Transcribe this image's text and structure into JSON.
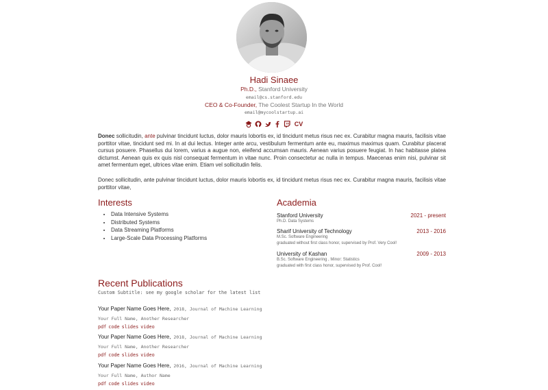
{
  "profile": {
    "name": "Hadi Sinaee",
    "degree": "Ph.D.,",
    "university": "Stanford University",
    "email1": "email@cs.stanford.edu",
    "role": "CEO & Co-Founder,",
    "company": "The Coolest Startup In the World",
    "email2": "email@mycoolstartup.ai",
    "social_icons": [
      "google-scholar-icon",
      "github-icon",
      "twitter-icon",
      "facebook-icon",
      "twitch-icon"
    ],
    "cv_label": "CV"
  },
  "bio": {
    "p1_bold": "Donec",
    "p1_a": " sollicitudin, ",
    "p1_link": "ante",
    "p1_b": " pulvinar tincidunt luctus, dolor mauris lobortis ex, id tincidunt metus risus nec ex. Curabitur magna mauris, facilisis vitae porttitor vitae, tincidunt sed mi. In at dui lectus. Integer ante arcu, vestibulum fermentum ante eu, maximus maximus quam. Curabitur placerat cursus posuere. Phasellus dui lorem, varius a augue non, eleifend accumsan mauris. Aenean varius posuere feugiat. In hac habitasse platea dictumst. Aenean quis ex quis nisl consequat fermentum in vitae nunc. Proin consectetur ac nulla in tempus. Maecenas enim nisi, pulvinar sit amet fermentum eget, ultrices vitae enim. Etiam vel sollicitudin felis.",
    "p2": "Donec sollicitudin, ante pulvinar tincidunt luctus, dolor mauris lobortis ex, id tincidunt metus risus nec ex. Curabitur magna mauris, facilisis vitae porttitor vitae,"
  },
  "interests": {
    "title": "Interests",
    "items": [
      "Data Intensive Systems",
      "Distributed Systems",
      "Data Streaming Platforms",
      "Large-Scale Data Processing Platforms"
    ]
  },
  "academia": {
    "title": "Academia",
    "entries": [
      {
        "school": "Stanford University",
        "years": "2021 - present",
        "line1": "Ph.D. Data Systems",
        "line2": ""
      },
      {
        "school": "Sharif University of Technology",
        "years": "2013 - 2016",
        "line1": "M.Sc. Software Engineering",
        "line2": "graduated without first class honor, supervised by Prof. Very Cool!"
      },
      {
        "school": "University of Kashan",
        "years": "2009 - 2013",
        "line1": "B.Sc. Software Engineering , Minor: Statistics",
        "line2": "graduated with first class honor, supervised by Prof. Cool!"
      }
    ]
  },
  "publications": {
    "title": "Recent Publications",
    "subtitle": "Custom Subtitle: see my google scholar for the latest list",
    "link_labels": [
      "pdf",
      "code",
      "slides",
      "video"
    ],
    "items": [
      {
        "title": "Your Paper Name Goes Here,",
        "venue": " 2018, Journal of Machine Learning",
        "authors": "Your Full Name, Another Researcher"
      },
      {
        "title": "Your Paper Name Goes Here,",
        "venue": " 2018, Journal of Machine Learning",
        "authors": "Your Full Name, Another Researcher"
      },
      {
        "title": "Your Paper Name Goes Here,",
        "venue": " 2016, Journal of Machine Learning",
        "authors": "Your Full Name, Author Name"
      }
    ]
  },
  "colors": {
    "accent": "#8b1a1a",
    "text": "#333333",
    "muted": "#777777"
  }
}
